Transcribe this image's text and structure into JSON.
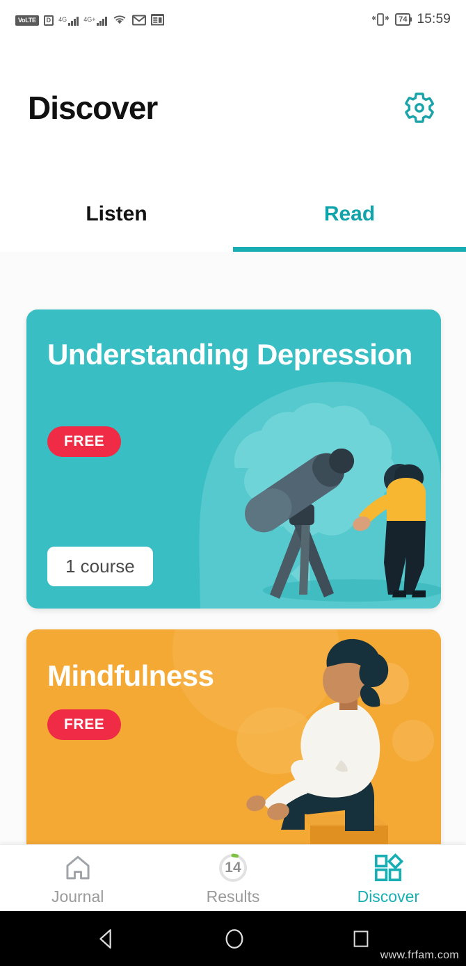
{
  "status_bar": {
    "volte_label": "VoLTE",
    "sim_label": "D",
    "network_1": "4G",
    "network_2": "4G+",
    "wifi_icon": "wifi-icon",
    "mail_icon": "gmail-icon",
    "news_icon": "news-icon",
    "vibrate_icon": "vibrate-icon",
    "battery_level": "74",
    "time": "15:59"
  },
  "header": {
    "title": "Discover",
    "settings_icon": "gear-icon",
    "accent_color": "#18aeb4"
  },
  "tabs": [
    {
      "label": "Listen",
      "active": false
    },
    {
      "label": "Read",
      "active": true
    }
  ],
  "cards": [
    {
      "title": "Understanding Depression",
      "badge": "FREE",
      "badge_color": "#ef2b45",
      "count_label": "1 course",
      "background_color": "#38bec3",
      "illustration": "person-with-telescope-and-brain"
    },
    {
      "title": "Mindfulness",
      "badge": "FREE",
      "badge_color": "#ef2b45",
      "count_label": "",
      "background_color": "#f4a935",
      "illustration": "woman-meditating-seated"
    }
  ],
  "bottom_nav": [
    {
      "label": "Journal",
      "icon": "home-icon",
      "active": false,
      "badge": ""
    },
    {
      "label": "Results",
      "icon": "progress-ring-icon",
      "active": false,
      "badge": "14"
    },
    {
      "label": "Discover",
      "icon": "grid-diamond-icon",
      "active": true,
      "badge": ""
    }
  ],
  "android_nav": {
    "back_icon": "back-triangle-icon",
    "home_icon": "home-circle-icon",
    "recents_icon": "recents-square-icon"
  },
  "watermark": "www.frfam.com"
}
